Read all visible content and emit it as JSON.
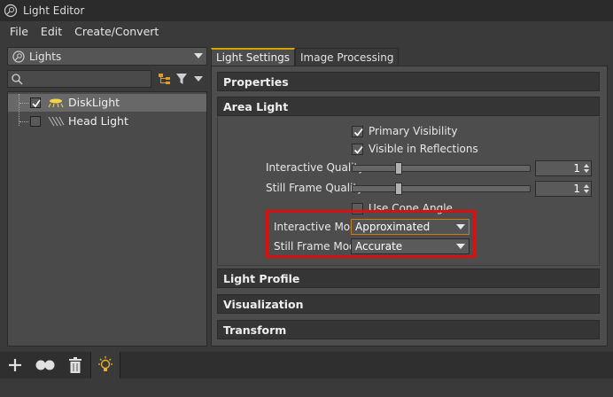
{
  "window": {
    "title": "Light Editor"
  },
  "menu": {
    "items": [
      "File",
      "Edit",
      "Create/Convert"
    ]
  },
  "left": {
    "combo_label": "Lights",
    "search_placeholder": "",
    "tree": [
      {
        "label": "DiskLight",
        "checked": true,
        "icon": "disk-light-icon",
        "selected": true
      },
      {
        "label": "Head Light",
        "checked": false,
        "icon": "head-light-icon",
        "selected": false
      }
    ]
  },
  "tabs": [
    "Light Settings",
    "Image Processing"
  ],
  "sections": {
    "properties": "Properties",
    "area_light": "Area Light",
    "light_profile": "Light Profile",
    "visualization": "Visualization",
    "transform": "Transform"
  },
  "area_light": {
    "primary_visibility": {
      "label": "Primary Visibility",
      "checked": true
    },
    "visible_in_reflections": {
      "label": "Visible in Reflections",
      "checked": true
    },
    "interactive_quality": {
      "label": "Interactive Quality",
      "value": "1"
    },
    "still_frame_quality": {
      "label": "Still Frame Quality",
      "value": "1"
    },
    "use_cone_angle": {
      "label": "Use Cone Angle",
      "checked": false
    },
    "interactive_mode": {
      "label": "Interactive Mode",
      "value": "Approximated"
    },
    "still_frame_mode": {
      "label": "Still Frame Mode",
      "value": "Accurate"
    }
  },
  "colors": {
    "accent": "#d8a200",
    "highlight": "#d81010",
    "bg": "#3a3a3a"
  }
}
